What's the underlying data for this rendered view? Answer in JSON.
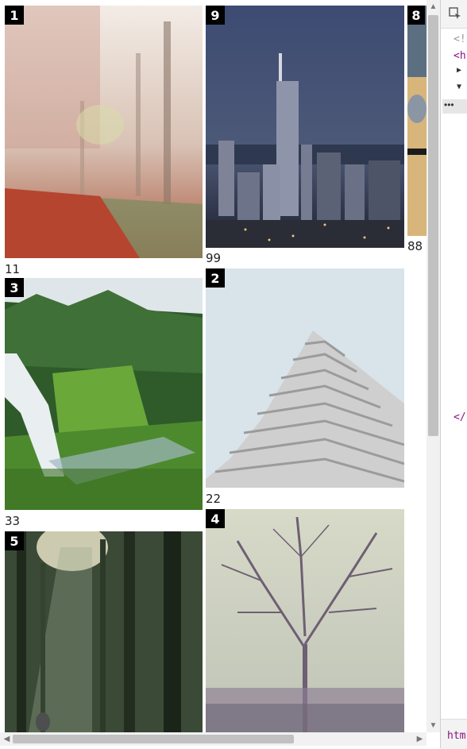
{
  "cards": [
    {
      "badge": "1",
      "caption": "11"
    },
    {
      "badge": "9",
      "caption": "99"
    },
    {
      "badge": "8",
      "caption": "88"
    },
    {
      "badge": "3",
      "caption": "33"
    },
    {
      "badge": "2",
      "caption": "22"
    },
    {
      "badge": "5",
      "caption": ""
    },
    {
      "badge": "4",
      "caption": ""
    }
  ],
  "devtools": {
    "lines": [
      "<!",
      "<h",
      "▶",
      "▼",
      "</"
    ],
    "more": "•••",
    "crumb": "htm"
  },
  "colors": {
    "badge_bg": "#000000",
    "scroll_thumb": "#c1c1c1",
    "devtools_tag": "#881280"
  }
}
